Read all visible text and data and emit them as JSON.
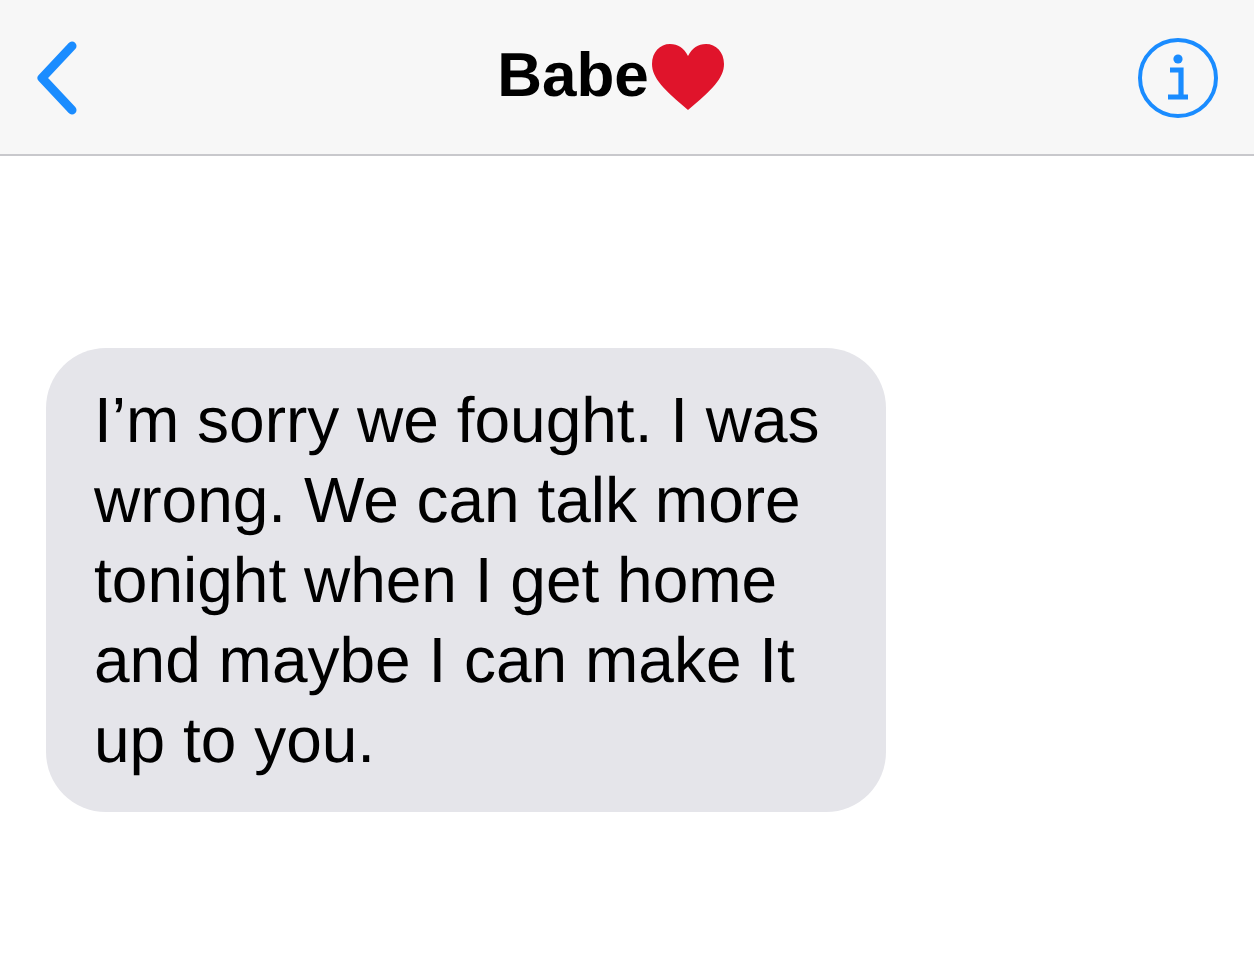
{
  "header": {
    "title": "Babe"
  },
  "messages": [
    {
      "text": "I’m sorry we fought. I was wrong. We can talk more tonight when I get home and maybe I can make It up to you.",
      "kind": "incoming"
    }
  ]
}
